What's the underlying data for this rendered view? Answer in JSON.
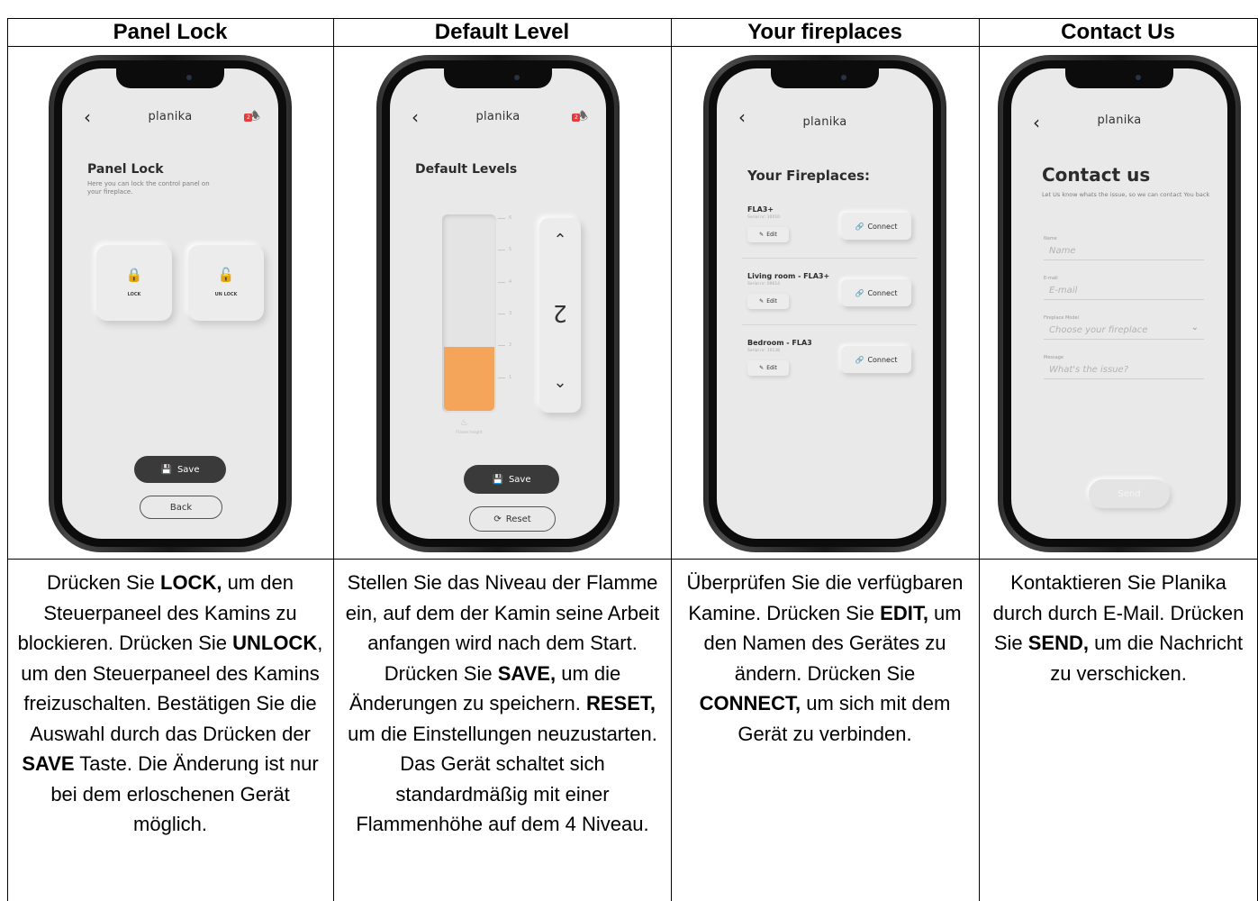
{
  "columns": [
    {
      "header": "Panel Lock"
    },
    {
      "header": "Default Level"
    },
    {
      "header": "Your fireplaces"
    },
    {
      "header": "Contact Us"
    }
  ],
  "captions": [
    [
      {
        "t": "Drücken Sie ",
        "b": false
      },
      {
        "t": "LOCK,",
        "b": true
      },
      {
        "t": " um den Steuerpaneel des Kamins zu blockieren. Drücken Sie ",
        "b": false
      },
      {
        "t": "UNLOCK",
        "b": true
      },
      {
        "t": ", um den Steuerpaneel des Kamins freizuschalten. Bestätigen Sie die Auswahl durch das Drücken der ",
        "b": false
      },
      {
        "t": "SAVE",
        "b": true
      },
      {
        "t": " Taste. Die Änderung ist nur bei dem erloschenen Gerät möglich.",
        "b": false
      }
    ],
    [
      {
        "t": "Stellen Sie das Niveau der Flamme ein, auf dem der Kamin seine Arbeit anfangen wird nach dem Start. Drücken Sie ",
        "b": false
      },
      {
        "t": "SAVE,",
        "b": true
      },
      {
        "t": " um die Änderungen zu speichern. ",
        "b": false
      },
      {
        "t": "RESET,",
        "b": true
      },
      {
        "t": "  um die Einstellungen  neuzustarten. Das Gerät schaltet sich standardmäßig mit einer Flammenhöhe auf dem 4 Niveau.",
        "b": false
      }
    ],
    [
      {
        "t": "Überprüfen Sie die verfügbaren Kamine. Drücken Sie ",
        "b": false
      },
      {
        "t": "EDIT,",
        "b": true
      },
      {
        "t": " um den Namen des Gerätes zu ändern. Drücken Sie ",
        "b": false
      },
      {
        "t": "CONNECT,",
        "b": true
      },
      {
        "t": " um sich mit dem Gerät zu verbinden.",
        "b": false
      }
    ],
    [
      {
        "t": "Kontaktieren Sie Planika durch durch E-Mail. Drücken Sie ",
        "b": false
      },
      {
        "t": "SEND,",
        "b": true
      },
      {
        "t": " um die Nachricht zu verschicken.",
        "b": false
      }
    ]
  ],
  "app": {
    "brand": "planika",
    "badge": "2"
  },
  "panel_lock": {
    "title": "Panel Lock",
    "subtitle": "Here you can lock the control panel on your fireplace.",
    "lock_label": "LOCK",
    "unlock_label": "UN LOCK",
    "save_label": "Save",
    "back_label": "Back"
  },
  "default_level": {
    "title": "Default Levels",
    "level_value": "2",
    "scale": [
      "6",
      "5",
      "4",
      "3",
      "2",
      "1"
    ],
    "fill_fraction": 0.33,
    "flame_label": "Flame height",
    "save_label": "Save",
    "reset_label": "Reset"
  },
  "fireplaces": {
    "title": "Your Fireplaces:",
    "items": [
      {
        "name": "FLA3+",
        "serial": "Serial nr: 10010",
        "edit": "Edit",
        "connect": "Connect"
      },
      {
        "name": "Living room - FLA3+",
        "serial": "Serial nr: 09614",
        "edit": "Edit",
        "connect": "Connect"
      },
      {
        "name": "Bedroom - FLA3",
        "serial": "Serial nr: 10138",
        "edit": "Edit",
        "connect": "Connect"
      }
    ]
  },
  "contact": {
    "title": "Contact us",
    "subtitle": "Let Us know whats the issue, so we can contact You back",
    "name_label": "Name",
    "name_placeholder": "Name",
    "email_label": "E-mail",
    "email_placeholder": "E-mail",
    "model_label": "Fireplace Model",
    "model_placeholder": "Choose your fireplace",
    "message_label": "Message",
    "message_placeholder": "What's the issue?",
    "send_label": "Send"
  },
  "colors": {
    "flame": "#f5a55a",
    "button_dark": "#3a3a3a",
    "screen_bg": "#e9e9ea",
    "badge": "#e23c3c"
  }
}
